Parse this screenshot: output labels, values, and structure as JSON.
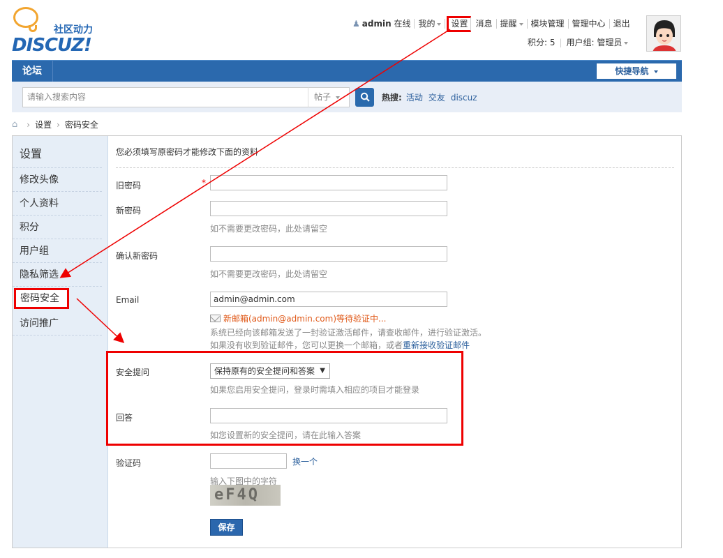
{
  "logo": {
    "text": "DISCUZ!",
    "subtitle": "社区动力"
  },
  "userbar": {
    "username": "admin",
    "status": "在线",
    "mine": "我的",
    "settings": "设置",
    "messages": "消息",
    "reminders": "提醒",
    "module_manage": "模块管理",
    "admin_center": "管理中心",
    "logout": "退出",
    "points": "积分: 5",
    "user_group": "用户组: 管理员"
  },
  "nav": {
    "title": "论坛",
    "quick_nav": "快捷导航"
  },
  "search": {
    "placeholder": "请输入搜索内容",
    "type": "帖子",
    "hot_label": "热搜:",
    "hot_terms": [
      "活动",
      "交友",
      "discuz"
    ]
  },
  "breadcrumb": [
    "设置",
    "密码安全"
  ],
  "sidebar": {
    "title": "设置",
    "items": [
      "修改头像",
      "个人资料",
      "积分",
      "用户组",
      "隐私筛选",
      "密码安全",
      "访问推广"
    ]
  },
  "form": {
    "notice": "您必须填写原密码才能修改下面的资料",
    "old_password_label": "旧密码",
    "new_password_label": "新密码",
    "new_password_hint": "如不需要更改密码，此处请留空",
    "confirm_password_label": "确认新密码",
    "confirm_password_hint": "如不需要更改密码，此处请留空",
    "email_label": "Email",
    "email_value": "admin@admin.com",
    "email_pending": "新邮箱(admin@admin.com)等待验证中...",
    "email_sent_hint": "系统已经向该邮箱发送了一封验证激活邮件，请查收邮件，进行验证激活。",
    "email_not_received": "如果没有收到验证邮件，您可以更换一个邮箱，或者",
    "resend_link": "重新接收验证邮件",
    "security_question_label": "安全提问",
    "security_question_value": "保持原有的安全提问和答案",
    "security_question_hint": "如果您启用安全提问，登录时需填入相应的项目才能登录",
    "answer_label": "回答",
    "answer_hint": "如您设置新的安全提问，请在此输入答案",
    "captcha_label": "验证码",
    "captcha_refresh": "换一个",
    "captcha_hint": "输入下图中的字符",
    "captcha_text": "eF4Q",
    "save_label": "保存",
    "required_mark": "*"
  },
  "colors": {
    "accent": "#2b69ad",
    "highlight": "#ee0000",
    "pending": "#e05a1a"
  }
}
